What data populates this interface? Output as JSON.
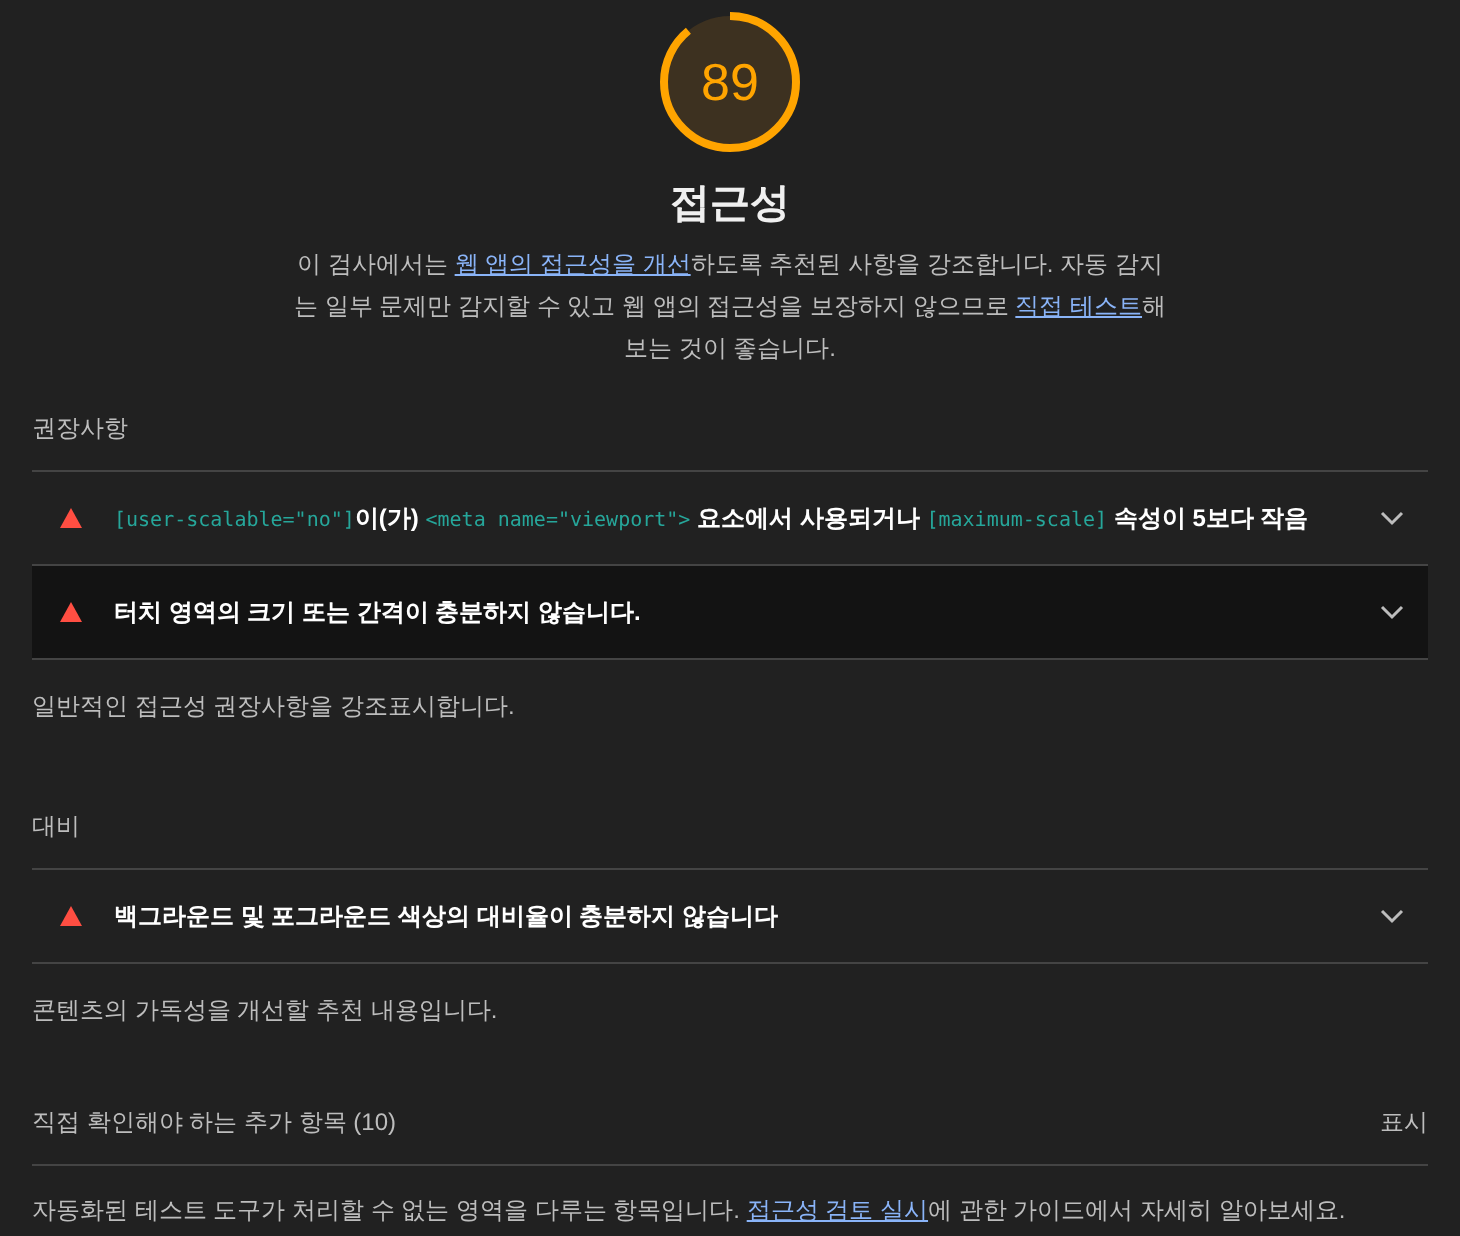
{
  "gauge": {
    "score": "89",
    "level": 0.89
  },
  "title": "접근성",
  "description": [
    {
      "kind": "text",
      "text": "이 검사에서는 "
    },
    {
      "kind": "link",
      "text": "웹 앱의 접근성을 개선"
    },
    {
      "kind": "text",
      "text": "하도록 추천된 사항을 강조합니다. 자동 감지는 일부 문제만 감지할 수 있고 웹 앱의 접근성을 보장하지 않으므로 "
    },
    {
      "kind": "link",
      "text": "직접 테스트"
    },
    {
      "kind": "text",
      "text": "해 보는 것이 좋습니다."
    }
  ],
  "groups": [
    {
      "title": "권장사항",
      "audits": [
        {
          "highlighted": false,
          "parts": [
            {
              "kind": "code",
              "text": "[user-scalable=\"no\"]"
            },
            {
              "kind": "text",
              "text": "이(가) "
            },
            {
              "kind": "code",
              "text": "<meta name=\"viewport\">"
            },
            {
              "kind": "text",
              "text": " 요소에서 사용되거나 "
            },
            {
              "kind": "code",
              "text": "[maximum-scale]"
            },
            {
              "kind": "text",
              "text": " 속성이 5보다 작음"
            }
          ]
        },
        {
          "highlighted": true,
          "parts": [
            {
              "kind": "text",
              "text": "터치 영역의 크기 또는 간격이 충분하지 않습니다."
            }
          ]
        }
      ],
      "note": "일반적인 접근성 권장사항을 강조표시합니다."
    },
    {
      "title": "대비",
      "audits": [
        {
          "highlighted": false,
          "parts": [
            {
              "kind": "text",
              "text": "백그라운드 및 포그라운드 색상의 대비율이 충분하지 않습니다"
            }
          ]
        }
      ],
      "note": "콘텐츠의 가독성을 개선할 추천 내용입니다."
    }
  ],
  "manual": {
    "title": "직접 확인해야 하는 추가 항목 (10)",
    "toggle": "표시",
    "description": [
      {
        "kind": "text",
        "text": "자동화된 테스트 도구가 처리할 수 없는 영역을 다루는 항목입니다. "
      },
      {
        "kind": "link",
        "text": "접근성 검토 실시"
      },
      {
        "kind": "text",
        "text": "에 관한 가이드에서 자세히 알아보세요."
      }
    ]
  }
}
